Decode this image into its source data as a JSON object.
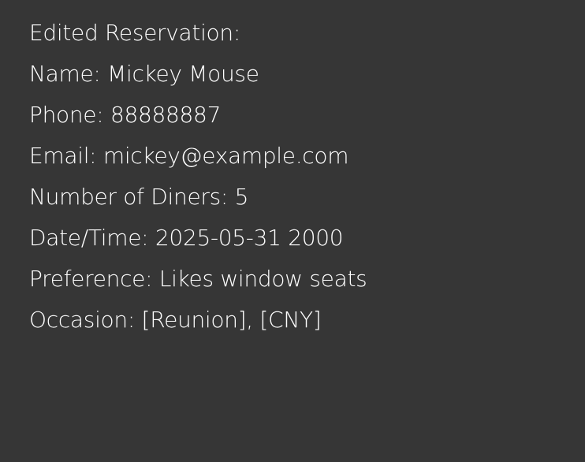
{
  "result": {
    "heading": "Edited Reservation:",
    "name": "Name: Mickey Mouse",
    "phone": "Phone: 88888887",
    "email": "Email: mickey@example.com",
    "diners": "Number of Diners: 5",
    "datetime": "Date/Time: 2025-05-31 2000",
    "preference": "Preference: Likes window seats",
    "occasion": "Occasion: [Reunion], [CNY]"
  },
  "colors": {
    "background": "#363636",
    "text": "#ffffff"
  }
}
